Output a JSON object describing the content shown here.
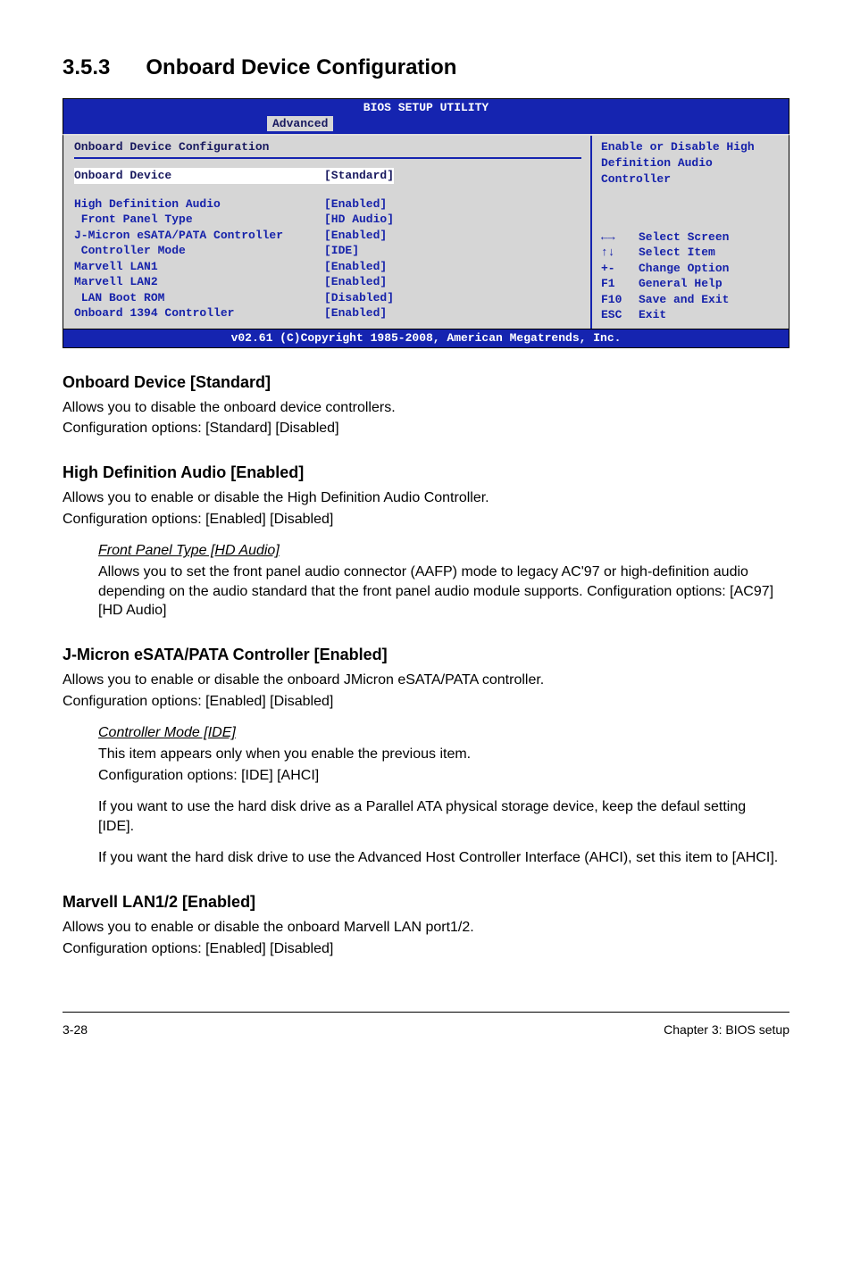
{
  "section": {
    "number": "3.5.3",
    "title": "Onboard Device Configuration"
  },
  "bios": {
    "header_title": "BIOS SETUP UTILITY",
    "active_tab": "Advanced",
    "panel_title": "Onboard Device Configuration",
    "rows": [
      {
        "label": "Onboard Device",
        "value": "[Standard]",
        "selected": true,
        "indent": 0
      },
      {
        "gap": true
      },
      {
        "label": "High Definition Audio",
        "value": "[Enabled]",
        "indent": 0
      },
      {
        "label": " Front Panel Type",
        "value": "[HD Audio]",
        "indent": 0
      },
      {
        "label": "J-Micron eSATA/PATA Controller",
        "value": "[Enabled]",
        "indent": 0
      },
      {
        "label": " Controller Mode",
        "value": "[IDE]",
        "indent": 0
      },
      {
        "label": "Marvell LAN1",
        "value": "[Enabled]",
        "indent": 0
      },
      {
        "label": "Marvell LAN2",
        "value": "[Enabled]",
        "indent": 0
      },
      {
        "label": " LAN Boot ROM",
        "value": "[Disabled]",
        "indent": 0
      },
      {
        "label": "Onboard 1394 Controller",
        "value": "[Enabled]",
        "indent": 0
      }
    ],
    "help_text": "Enable or Disable High Definition Audio Controller",
    "keys": [
      {
        "sym": "←→",
        "text": "Select Screen"
      },
      {
        "sym": "↑↓",
        "text": "Select Item"
      },
      {
        "sym": "+-",
        "text": "Change Option"
      },
      {
        "sym": "F1",
        "text": "General Help"
      },
      {
        "sym": "F10",
        "text": "Save and Exit"
      },
      {
        "sym": "ESC",
        "text": "Exit"
      }
    ],
    "footer": "v02.61 (C)Copyright 1985-2008, American Megatrends, Inc."
  },
  "content": {
    "s1": {
      "head": "Onboard Device [Standard]",
      "p1": "Allows you to disable the onboard device controllers.",
      "p2": "Configuration options: [Standard] [Disabled]"
    },
    "s2": {
      "head": "High Definition Audio [Enabled]",
      "p1": "Allows you to enable or disable the High Definition Audio Controller.",
      "p2": "Configuration options: [Enabled] [Disabled]",
      "sub": {
        "title": "Front Panel Type [HD Audio]",
        "body": "Allows you to set the front panel audio connector (AAFP) mode to legacy AC'97 or high-definition audio depending on the audio standard that the front panel audio module supports. Configuration options: [AC97] [HD Audio]"
      }
    },
    "s3": {
      "head": "J-Micron eSATA/PATA Controller [Enabled]",
      "p1": "Allows you to enable or disable the onboard JMicron eSATA/PATA controller.",
      "p2": "Configuration options: [Enabled] [Disabled]",
      "sub1": {
        "title": "Controller Mode [IDE]",
        "l1": "This item appears only when you enable the previous item.",
        "l2": "Configuration options: [IDE] [AHCI]"
      },
      "sub2": "If you want to use the hard disk drive as a Parallel ATA physical storage device, keep the defaul setting [IDE].",
      "sub3": "If you want the hard disk drive to use the Advanced Host Controller Interface (AHCI), set this item to [AHCI]."
    },
    "s4": {
      "head": "Marvell LAN1/2 [Enabled]",
      "p1": "Allows you to enable or disable the onboard Marvell LAN port1/2.",
      "p2": "Configuration options: [Enabled] [Disabled]"
    }
  },
  "footer": {
    "left": "3-28",
    "right": "Chapter 3: BIOS setup"
  }
}
